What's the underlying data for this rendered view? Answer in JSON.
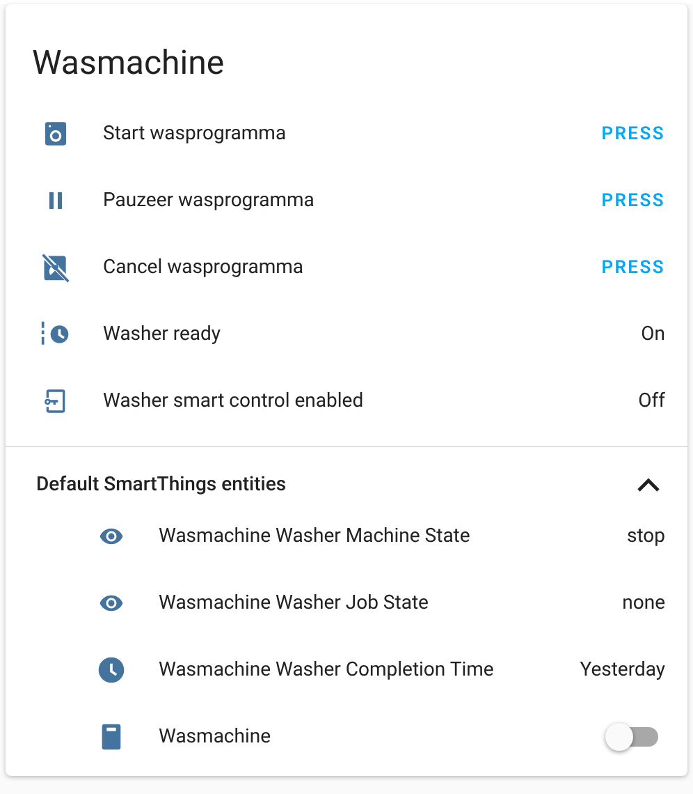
{
  "card": {
    "title": "Wasmachine",
    "rows": [
      {
        "name": "Start wasprogramma",
        "kind": "button",
        "action": "PRESS"
      },
      {
        "name": "Pauzeer wasprogramma",
        "kind": "button",
        "action": "PRESS"
      },
      {
        "name": "Cancel wasprogramma",
        "kind": "button",
        "action": "PRESS"
      },
      {
        "name": "Washer ready",
        "kind": "state",
        "value": "On"
      },
      {
        "name": "Washer smart control enabled",
        "kind": "state",
        "value": "Off"
      }
    ],
    "section": {
      "title": "Default SmartThings entities",
      "expanded": true,
      "rows": [
        {
          "name": "Wasmachine Washer Machine State",
          "kind": "state",
          "value": "stop"
        },
        {
          "name": "Wasmachine Washer Job State",
          "kind": "state",
          "value": "none"
        },
        {
          "name": "Wasmachine Washer Completion Time",
          "kind": "state",
          "value": "Yesterday"
        },
        {
          "name": "Wasmachine",
          "kind": "toggle",
          "on": false
        }
      ]
    }
  }
}
